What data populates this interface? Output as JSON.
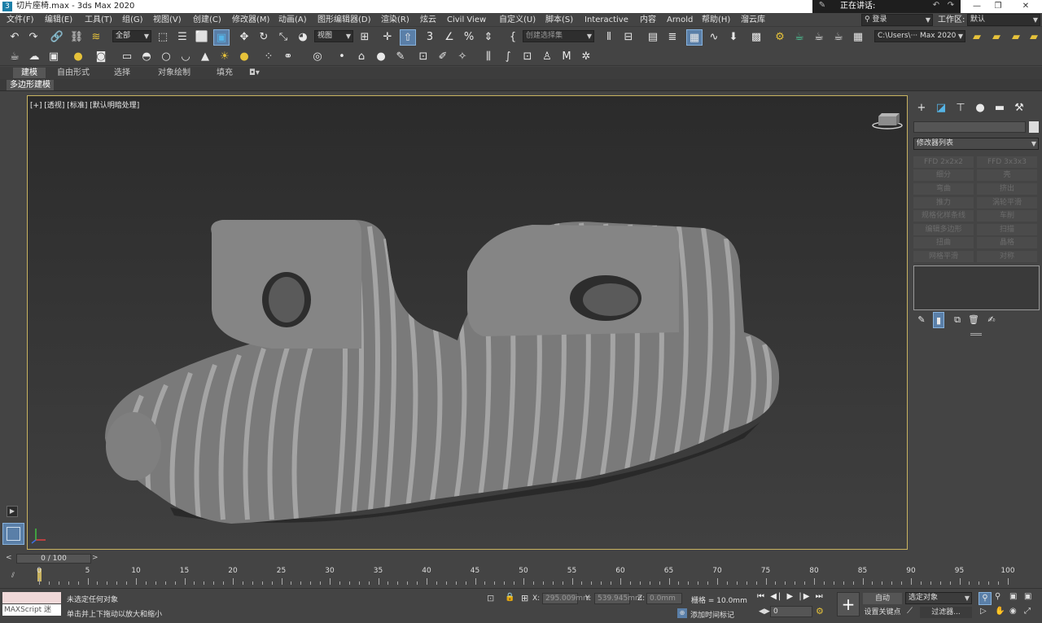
{
  "window": {
    "title": "切片座椅.max - 3ds Max 2020",
    "speaking_label": "正在讲话:",
    "controls": [
      "—",
      "❐",
      "✕"
    ]
  },
  "menu": {
    "items": [
      "文件(F)",
      "编辑(E)",
      "工具(T)",
      "组(G)",
      "视图(V)",
      "创建(C)",
      "修改器(M)",
      "动画(A)",
      "图形编辑器(D)",
      "渲染(R)",
      "炫云",
      "Civil View",
      "自定义(U)",
      "脚本(S)",
      "Interactive",
      "内容",
      "Arnold",
      "帮助(H)",
      "溜云库"
    ],
    "login_label": "登录",
    "workspace_label": "工作区:",
    "workspace_value": "默认"
  },
  "toolbar1": {
    "selection_filter": "全部",
    "ref_coord": "视图",
    "named_selection_placeholder": "创建选择集",
    "project_path": "C:\\Users\\··· Max 2020"
  },
  "ribbon": {
    "tabs": [
      "建模",
      "自由形式",
      "选择",
      "对象绘制",
      "填充"
    ],
    "active_tab": "建模",
    "panel_label": "多边形建模"
  },
  "viewport": {
    "label": "[+] [透视] [标准] [默认明暗处理]"
  },
  "command_panel": {
    "modifier_list_label": "修改器列表",
    "modifier_buttons": [
      "FFD 2x2x2",
      "FFD 3x3x3",
      "细分",
      "壳",
      "弯曲",
      "挤出",
      "推力",
      "涡轮平滑",
      "规格化样条线",
      "车削",
      "编辑多边形",
      "扫描",
      "扭曲",
      "晶格",
      "网格平滑",
      "对称"
    ]
  },
  "timeline": {
    "frame_counter": "0 / 100",
    "ticks": [
      "0",
      "5",
      "10",
      "15",
      "20",
      "25",
      "30",
      "35",
      "40",
      "45",
      "50",
      "55",
      "60",
      "65",
      "70",
      "75",
      "80",
      "85",
      "90",
      "95",
      "100"
    ]
  },
  "status": {
    "maxscript_label": "MAXScript 迷",
    "selection_status": "未选定任何对象",
    "prompt": "单击并上下拖动以放大和缩小",
    "x_label": "X:",
    "x_value": "295.009mm",
    "y_label": "Y:",
    "y_value": "539.945mm",
    "z_label": "Z:",
    "z_value": "0.0mm",
    "grid": "栅格 = 10.0mm",
    "add_time_tag": "添加时间标记",
    "frame_value": "0",
    "auto_key": "自动",
    "selected_object": "选定对象",
    "set_key": "设置关键点",
    "filters": "过滤器..."
  }
}
